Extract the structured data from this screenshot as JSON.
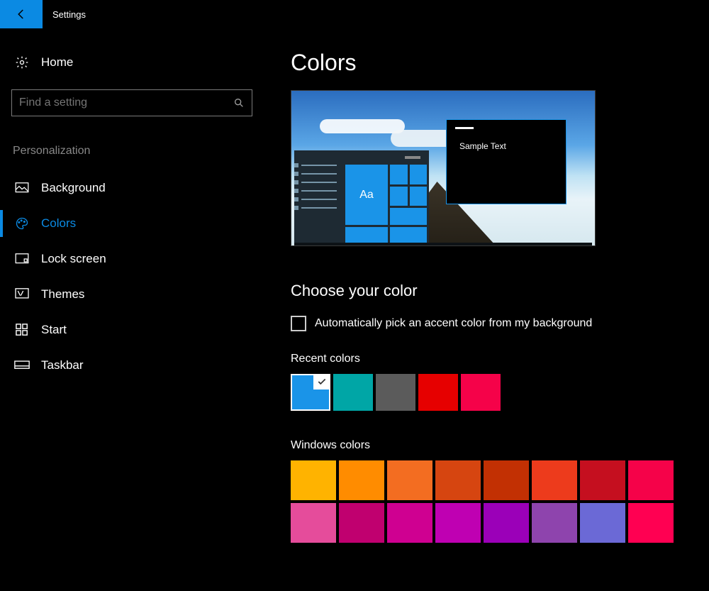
{
  "titlebar": {
    "title": "Settings"
  },
  "sidebar": {
    "home_label": "Home",
    "search_placeholder": "Find a setting",
    "section_title": "Personalization",
    "items": [
      {
        "label": "Background",
        "icon": "image-icon",
        "active": false
      },
      {
        "label": "Colors",
        "icon": "palette-icon",
        "active": true
      },
      {
        "label": "Lock screen",
        "icon": "lock-screen-icon",
        "active": false
      },
      {
        "label": "Themes",
        "icon": "themes-icon",
        "active": false
      },
      {
        "label": "Start",
        "icon": "start-icon",
        "active": false
      },
      {
        "label": "Taskbar",
        "icon": "taskbar-icon",
        "active": false
      }
    ]
  },
  "main": {
    "page_title": "Colors",
    "preview": {
      "sample_text": "Sample Text",
      "tile_text": "Aa"
    },
    "choose_heading": "Choose your color",
    "auto_pick_label": "Automatically pick an accent color from my background",
    "auto_pick_checked": false,
    "recent_label": "Recent colors",
    "recent_colors": [
      {
        "hex": "#1a94e8",
        "selected": true
      },
      {
        "hex": "#00a6a6",
        "selected": false
      },
      {
        "hex": "#5b5b5b",
        "selected": false
      },
      {
        "hex": "#e60000",
        "selected": false
      },
      {
        "hex": "#f50249",
        "selected": false
      }
    ],
    "windows_colors_label": "Windows colors",
    "windows_colors": [
      "#ffb300",
      "#ff8c00",
      "#f36d21",
      "#d64510",
      "#c23003",
      "#ed3b1c",
      "#c50f1f",
      "#f50249",
      "#e54c9b",
      "#c0006f",
      "#cf0091",
      "#bf00b2",
      "#9b00b8",
      "#8e44ad",
      "#6b69d6",
      "#ff0052"
    ],
    "accent_color": "#1a94e8"
  }
}
